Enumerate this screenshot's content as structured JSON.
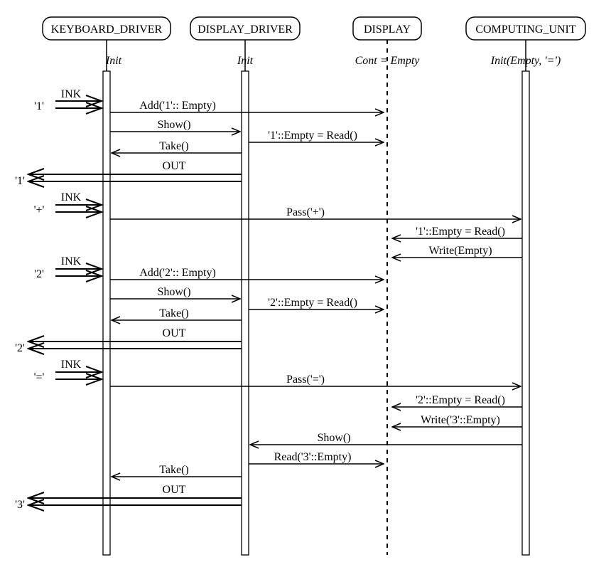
{
  "lifelines": {
    "kbd": {
      "label": "KEYBOARD_DRIVER",
      "state": "Init"
    },
    "disp_drv": {
      "label": "DISPLAY_DRIVER",
      "state": "Init"
    },
    "disp": {
      "label": "DISPLAY",
      "state": "Cont = Empty"
    },
    "cpu": {
      "label": "COMPUTING_UNIT",
      "state": "Init(Empty, '=')"
    }
  },
  "keys": {
    "k1": "'1'",
    "k_plus": "'+'",
    "k2": "'2'",
    "k_eq": "'='",
    "out1": "'1'",
    "out2": "'2'",
    "out3": "'3'"
  },
  "labels": {
    "ink": "INK",
    "out": "OUT"
  },
  "messages": {
    "add1": "Add('1':: Empty)",
    "show": "Show()",
    "read1": "'1'::Empty  = Read()",
    "take": "Take()",
    "pass_plus": "Pass('+')",
    "read1b": "'1'::Empty  = Read()",
    "write_empty": "Write(Empty)",
    "add2": "Add('2':: Empty)",
    "read2": "'2'::Empty  = Read()",
    "pass_eq": "Pass('=')",
    "read2b": "'2'::Empty  = Read()",
    "write3": "Write('3'::Empty)",
    "read3": "Read('3'::Empty)"
  }
}
